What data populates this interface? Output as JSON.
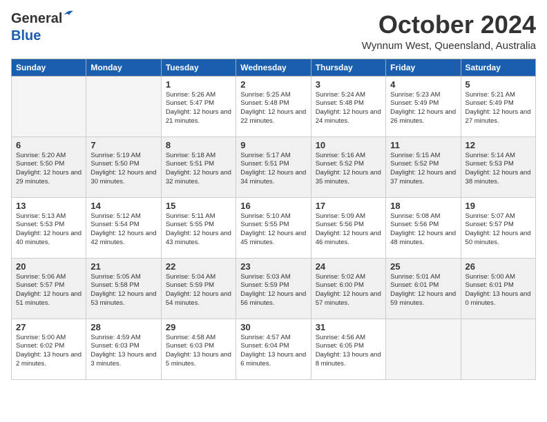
{
  "header": {
    "logo": {
      "general": "General",
      "blue": "Blue",
      "tagline": "GeneralBlue"
    },
    "title": "October 2024",
    "subtitle": "Wynnum West, Queensland, Australia"
  },
  "columns": [
    "Sunday",
    "Monday",
    "Tuesday",
    "Wednesday",
    "Thursday",
    "Friday",
    "Saturday"
  ],
  "weeks": [
    [
      {
        "day": "",
        "sunrise": "",
        "sunset": "",
        "daylight": ""
      },
      {
        "day": "",
        "sunrise": "",
        "sunset": "",
        "daylight": ""
      },
      {
        "day": "1",
        "sunrise": "Sunrise: 5:26 AM",
        "sunset": "Sunset: 5:47 PM",
        "daylight": "Daylight: 12 hours and 21 minutes."
      },
      {
        "day": "2",
        "sunrise": "Sunrise: 5:25 AM",
        "sunset": "Sunset: 5:48 PM",
        "daylight": "Daylight: 12 hours and 22 minutes."
      },
      {
        "day": "3",
        "sunrise": "Sunrise: 5:24 AM",
        "sunset": "Sunset: 5:48 PM",
        "daylight": "Daylight: 12 hours and 24 minutes."
      },
      {
        "day": "4",
        "sunrise": "Sunrise: 5:23 AM",
        "sunset": "Sunset: 5:49 PM",
        "daylight": "Daylight: 12 hours and 26 minutes."
      },
      {
        "day": "5",
        "sunrise": "Sunrise: 5:21 AM",
        "sunset": "Sunset: 5:49 PM",
        "daylight": "Daylight: 12 hours and 27 minutes."
      }
    ],
    [
      {
        "day": "6",
        "sunrise": "Sunrise: 5:20 AM",
        "sunset": "Sunset: 5:50 PM",
        "daylight": "Daylight: 12 hours and 29 minutes."
      },
      {
        "day": "7",
        "sunrise": "Sunrise: 5:19 AM",
        "sunset": "Sunset: 5:50 PM",
        "daylight": "Daylight: 12 hours and 30 minutes."
      },
      {
        "day": "8",
        "sunrise": "Sunrise: 5:18 AM",
        "sunset": "Sunset: 5:51 PM",
        "daylight": "Daylight: 12 hours and 32 minutes."
      },
      {
        "day": "9",
        "sunrise": "Sunrise: 5:17 AM",
        "sunset": "Sunset: 5:51 PM",
        "daylight": "Daylight: 12 hours and 34 minutes."
      },
      {
        "day": "10",
        "sunrise": "Sunrise: 5:16 AM",
        "sunset": "Sunset: 5:52 PM",
        "daylight": "Daylight: 12 hours and 35 minutes."
      },
      {
        "day": "11",
        "sunrise": "Sunrise: 5:15 AM",
        "sunset": "Sunset: 5:52 PM",
        "daylight": "Daylight: 12 hours and 37 minutes."
      },
      {
        "day": "12",
        "sunrise": "Sunrise: 5:14 AM",
        "sunset": "Sunset: 5:53 PM",
        "daylight": "Daylight: 12 hours and 38 minutes."
      }
    ],
    [
      {
        "day": "13",
        "sunrise": "Sunrise: 5:13 AM",
        "sunset": "Sunset: 5:53 PM",
        "daylight": "Daylight: 12 hours and 40 minutes."
      },
      {
        "day": "14",
        "sunrise": "Sunrise: 5:12 AM",
        "sunset": "Sunset: 5:54 PM",
        "daylight": "Daylight: 12 hours and 42 minutes."
      },
      {
        "day": "15",
        "sunrise": "Sunrise: 5:11 AM",
        "sunset": "Sunset: 5:55 PM",
        "daylight": "Daylight: 12 hours and 43 minutes."
      },
      {
        "day": "16",
        "sunrise": "Sunrise: 5:10 AM",
        "sunset": "Sunset: 5:55 PM",
        "daylight": "Daylight: 12 hours and 45 minutes."
      },
      {
        "day": "17",
        "sunrise": "Sunrise: 5:09 AM",
        "sunset": "Sunset: 5:56 PM",
        "daylight": "Daylight: 12 hours and 46 minutes."
      },
      {
        "day": "18",
        "sunrise": "Sunrise: 5:08 AM",
        "sunset": "Sunset: 5:56 PM",
        "daylight": "Daylight: 12 hours and 48 minutes."
      },
      {
        "day": "19",
        "sunrise": "Sunrise: 5:07 AM",
        "sunset": "Sunset: 5:57 PM",
        "daylight": "Daylight: 12 hours and 50 minutes."
      }
    ],
    [
      {
        "day": "20",
        "sunrise": "Sunrise: 5:06 AM",
        "sunset": "Sunset: 5:57 PM",
        "daylight": "Daylight: 12 hours and 51 minutes."
      },
      {
        "day": "21",
        "sunrise": "Sunrise: 5:05 AM",
        "sunset": "Sunset: 5:58 PM",
        "daylight": "Daylight: 12 hours and 53 minutes."
      },
      {
        "day": "22",
        "sunrise": "Sunrise: 5:04 AM",
        "sunset": "Sunset: 5:59 PM",
        "daylight": "Daylight: 12 hours and 54 minutes."
      },
      {
        "day": "23",
        "sunrise": "Sunrise: 5:03 AM",
        "sunset": "Sunset: 5:59 PM",
        "daylight": "Daylight: 12 hours and 56 minutes."
      },
      {
        "day": "24",
        "sunrise": "Sunrise: 5:02 AM",
        "sunset": "Sunset: 6:00 PM",
        "daylight": "Daylight: 12 hours and 57 minutes."
      },
      {
        "day": "25",
        "sunrise": "Sunrise: 5:01 AM",
        "sunset": "Sunset: 6:01 PM",
        "daylight": "Daylight: 12 hours and 59 minutes."
      },
      {
        "day": "26",
        "sunrise": "Sunrise: 5:00 AM",
        "sunset": "Sunset: 6:01 PM",
        "daylight": "Daylight: 13 hours and 0 minutes."
      }
    ],
    [
      {
        "day": "27",
        "sunrise": "Sunrise: 5:00 AM",
        "sunset": "Sunset: 6:02 PM",
        "daylight": "Daylight: 13 hours and 2 minutes."
      },
      {
        "day": "28",
        "sunrise": "Sunrise: 4:59 AM",
        "sunset": "Sunset: 6:03 PM",
        "daylight": "Daylight: 13 hours and 3 minutes."
      },
      {
        "day": "29",
        "sunrise": "Sunrise: 4:58 AM",
        "sunset": "Sunset: 6:03 PM",
        "daylight": "Daylight: 13 hours and 5 minutes."
      },
      {
        "day": "30",
        "sunrise": "Sunrise: 4:57 AM",
        "sunset": "Sunset: 6:04 PM",
        "daylight": "Daylight: 13 hours and 6 minutes."
      },
      {
        "day": "31",
        "sunrise": "Sunrise: 4:56 AM",
        "sunset": "Sunset: 6:05 PM",
        "daylight": "Daylight: 13 hours and 8 minutes."
      },
      {
        "day": "",
        "sunrise": "",
        "sunset": "",
        "daylight": ""
      },
      {
        "day": "",
        "sunrise": "",
        "sunset": "",
        "daylight": ""
      }
    ]
  ]
}
